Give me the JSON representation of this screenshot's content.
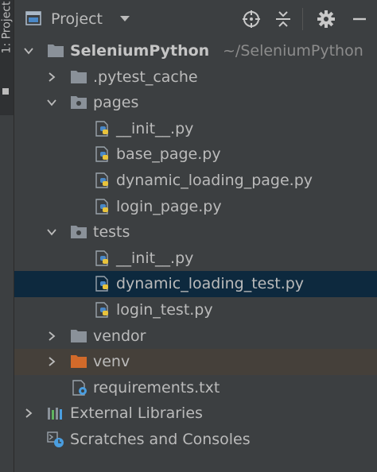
{
  "side_tab": {
    "label": "1: Project"
  },
  "header": {
    "title": "Project",
    "caret_icon": "triangle-down-icon",
    "buttons": [
      "locate-icon",
      "collapse-all-icon",
      "settings-icon",
      "hide-icon"
    ]
  },
  "tree": {
    "root": {
      "label": "SeleniumPython",
      "path": "~/SeleniumPython"
    },
    "pytest_cache": {
      "label": ".pytest_cache"
    },
    "pages": {
      "label": "pages",
      "files": [
        "__init__.py",
        "base_page.py",
        "dynamic_loading_page.py",
        "login_page.py"
      ]
    },
    "tests": {
      "label": "tests",
      "files": [
        "__init__.py",
        "dynamic_loading_test.py",
        "login_test.py"
      ]
    },
    "vendor": {
      "label": "vendor"
    },
    "venv": {
      "label": "venv"
    },
    "requirements": {
      "label": "requirements.txt"
    },
    "external_libraries": {
      "label": "External Libraries"
    },
    "scratches": {
      "label": "Scratches and Consoles"
    }
  },
  "colors": {
    "background": "#3c3f41",
    "selection": "#0d293e",
    "venv_highlight": "#45403a",
    "venv_folder": "#d26a2a",
    "folder": "#8a9199"
  }
}
